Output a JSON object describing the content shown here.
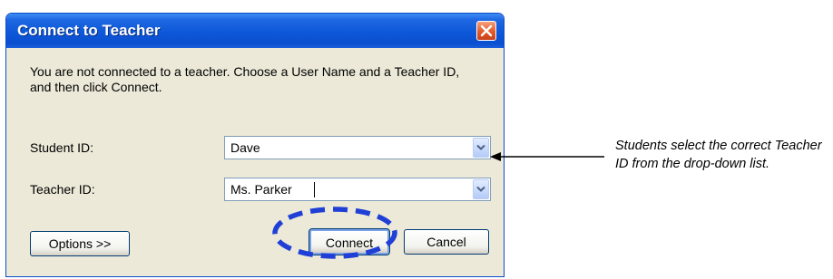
{
  "dialog": {
    "title": "Connect to Teacher",
    "message": "You are not connected to a teacher. Choose a User Name and a Teacher ID, and then click Connect.",
    "student_id": {
      "label": "Student ID:",
      "value": "Dave"
    },
    "teacher_id": {
      "label": "Teacher ID:",
      "value": "Ms. Parker"
    },
    "buttons": {
      "options": "Options >>",
      "connect": "Connect",
      "cancel": "Cancel"
    }
  },
  "annotation": {
    "text": "Students select the correct Teacher ID from the drop-down list."
  },
  "colors": {
    "titlebar": "#0a4fcf",
    "highlight_circle": "#1f3fd6",
    "close_button": "#e25a27"
  }
}
